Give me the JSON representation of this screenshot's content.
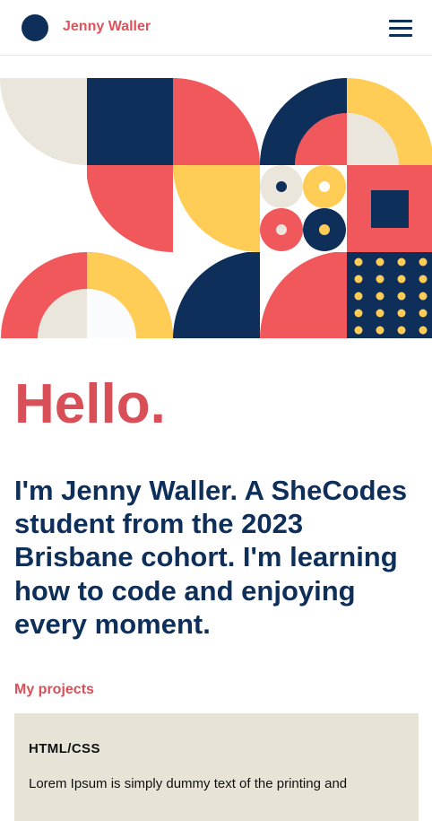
{
  "nav": {
    "brand_name": "Jenny Waller",
    "menu_icon": "hamburger-menu-icon"
  },
  "hero": {
    "illustration": "geometric-shapes-illustration",
    "colors": {
      "navy": "#0e2f5a",
      "coral": "#f0585c",
      "yellow": "#ffcc55",
      "cream": "#ebe6dc"
    }
  },
  "main": {
    "greeting": "Hello.",
    "intro": "I'm Jenny Waller. A SheCodes student from the 2023 Brisbane cohort. I'm learning how to code and enjoying every moment."
  },
  "projects": {
    "heading": "My projects",
    "items": [
      {
        "title": "HTML/CSS",
        "description": "Lorem Ipsum is simply dummy text of the printing and"
      }
    ]
  }
}
